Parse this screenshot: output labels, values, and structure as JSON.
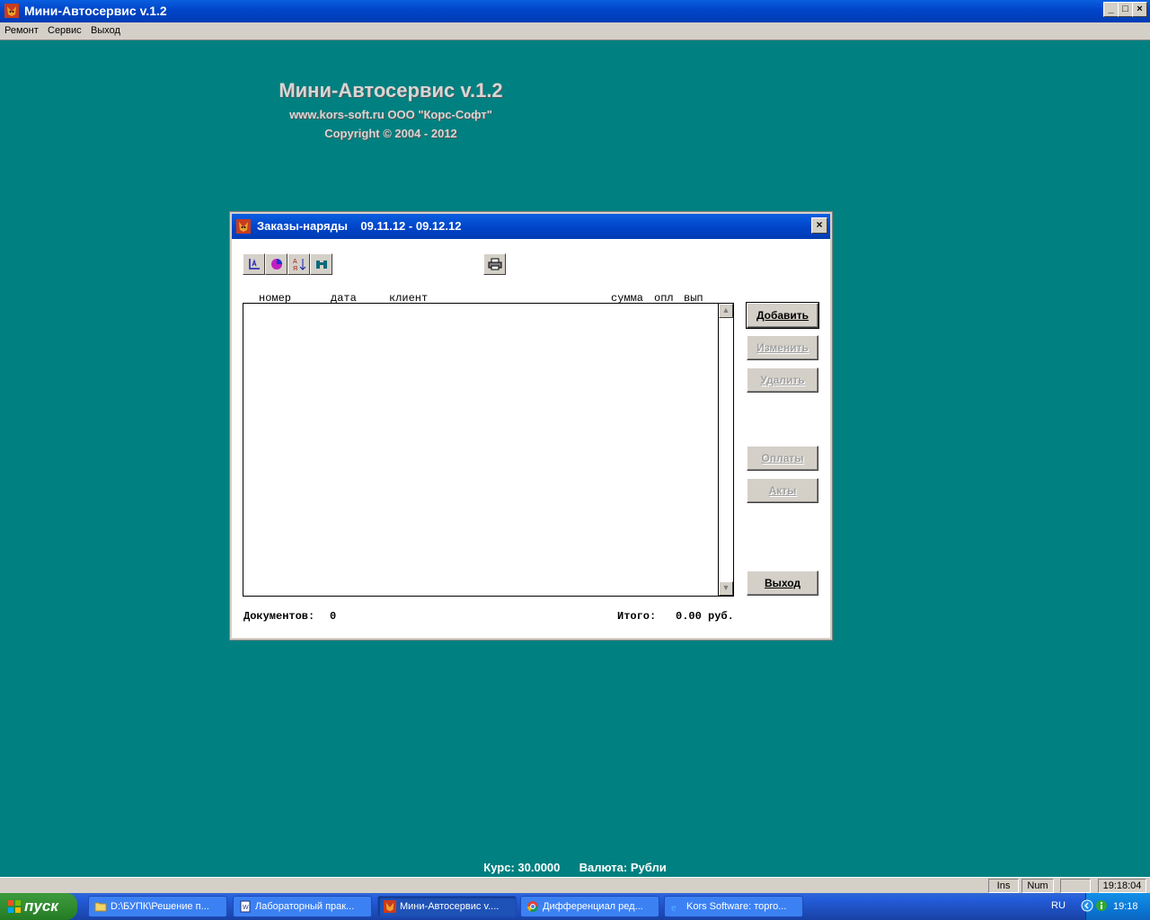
{
  "window": {
    "title": "Мини-Автосервис v.1.2",
    "minimize": "_",
    "maximize": "□",
    "close": "×"
  },
  "menu": [
    "Ремонт",
    "Сервис",
    "Выход"
  ],
  "splash": {
    "title": "Мини-Автосервис v.1.2",
    "site": "www.kors-soft.ru  ООО \"Корс-Софт\"",
    "copyright": "Copyright © 2004 - 2012"
  },
  "dialog": {
    "title": "Заказы-наряды    09.11.12 - 09.12.12",
    "close": "×",
    "columns": {
      "number": "номер",
      "date": "дата",
      "client": "клиент",
      "sum": "сумма",
      "paid": "опл",
      "done": "вып"
    },
    "buttons": {
      "add": "Добавить",
      "edit": "Изменить",
      "delete": "Удалить",
      "payments": "Оплаты",
      "acts": "Акты",
      "exit": "Выход"
    },
    "footer": {
      "docs_label": "Документов:",
      "docs_count": "0",
      "total_label": "Итого:",
      "total_value": "0.00 руб."
    }
  },
  "rate": {
    "label": "Курс: 30.0000",
    "currency": "Валюта: Рубли"
  },
  "statusbar": {
    "ins": "Ins",
    "num": "Num",
    "time": "19:18:04"
  },
  "taskbar": {
    "start": "пуск",
    "tasks": [
      "D:\\БУПК\\Решение п...",
      "Лабораторный прак...",
      "Мини-Автосервис v....",
      "Дифференциал ред...",
      "Kors Software: торго..."
    ],
    "lang": "RU",
    "clock": "19:18"
  },
  "colors": {
    "desktop": "#008080",
    "title_blue": "#0044c8",
    "taskbar": "#245edb",
    "start_green": "#2f8a2f"
  }
}
